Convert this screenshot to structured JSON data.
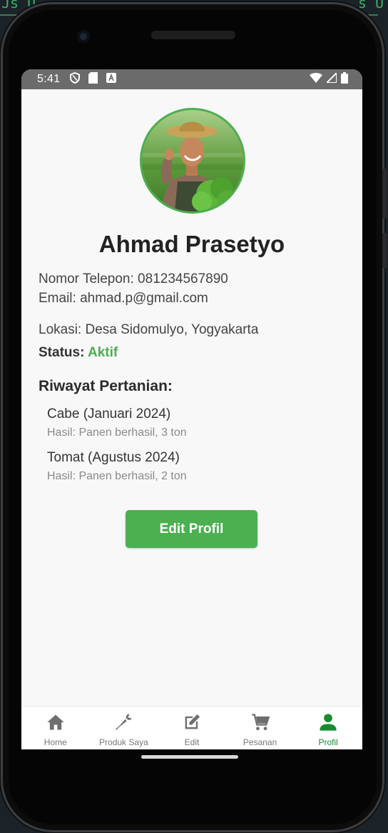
{
  "background": {
    "code_left": "Js U",
    "code_right": "s U"
  },
  "statusbar": {
    "time": "5:41",
    "icons_left": [
      "shield-icon",
      "sd-card-icon",
      "font-a-icon"
    ],
    "icons_right": [
      "wifi-icon",
      "signal-icon",
      "battery-icon"
    ]
  },
  "profile": {
    "name": "Ahmad Prasetyo",
    "phone": "Nomor Telepon: 081234567890",
    "email": "Email: ahmad.p@gmail.com",
    "location": "Lokasi: Desa Sidomulyo, Yogyakarta",
    "status_label": "Status: ",
    "status_value": "Aktif"
  },
  "history": {
    "title": "Riwayat Pertanian:",
    "items": [
      {
        "title": "Cabe (Januari 2024)",
        "result": "Hasil: Panen berhasil, 3 ton"
      },
      {
        "title": "Tomat (Agustus 2024)",
        "result": "Hasil: Panen berhasil, 2 ton"
      }
    ]
  },
  "actions": {
    "edit_label": "Edit Profil"
  },
  "bottom_nav": {
    "items": [
      {
        "label": "Home",
        "icon": "home-icon"
      },
      {
        "label": "Produk Saya",
        "icon": "carrot-icon"
      },
      {
        "label": "Edit",
        "icon": "edit-icon"
      },
      {
        "label": "Pesanan",
        "icon": "cart-icon"
      },
      {
        "label": "Profil",
        "icon": "person-icon",
        "active": true
      }
    ]
  },
  "colors": {
    "accent": "#4caf50",
    "nav_active": "#1a8a2e",
    "statusbar": "#6b6b6b"
  }
}
